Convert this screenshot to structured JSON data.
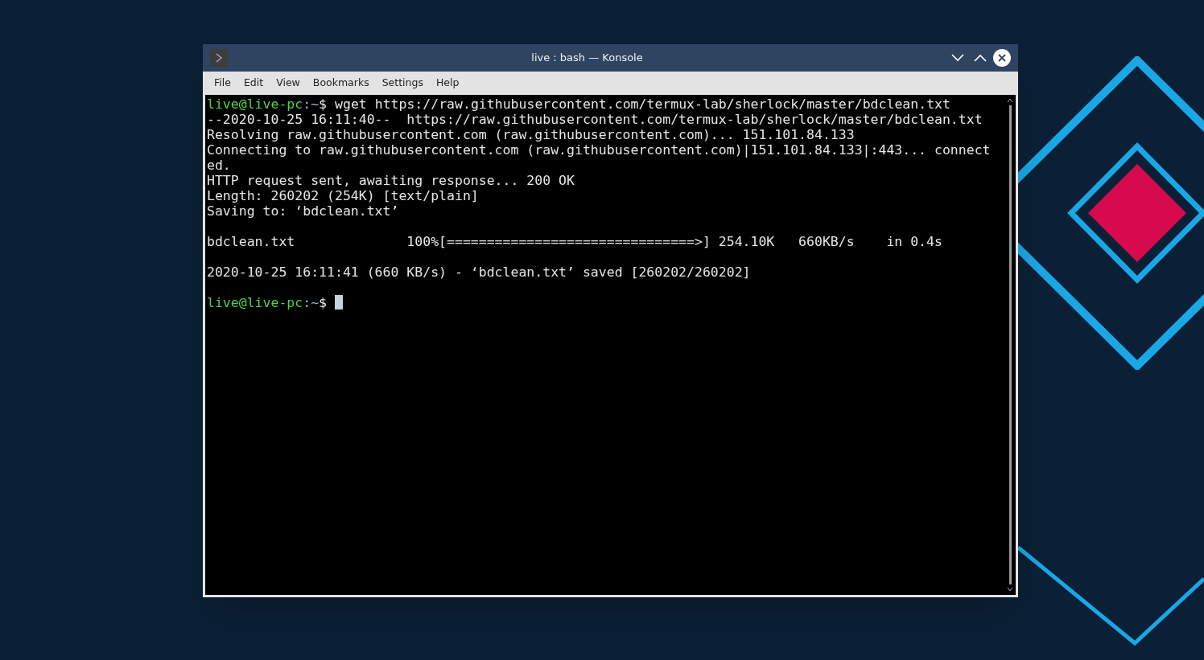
{
  "window": {
    "title": "live : bash — Konsole"
  },
  "menu": [
    "File",
    "Edit",
    "View",
    "Bookmarks",
    "Settings",
    "Help"
  ],
  "terminal": {
    "lines": [
      {
        "kind": "prompt",
        "user_host": "live@live-pc",
        "path": ":~",
        "symbol": "$",
        "command": "wget https://raw.githubusercontent.com/termux-lab/sherlock/master/bdclean.txt"
      },
      {
        "kind": "output",
        "text": "--2020-10-25 16:11:40--  https://raw.githubusercontent.com/termux-lab/sherlock/master/bdclean.txt"
      },
      {
        "kind": "output",
        "text": "Resolving raw.githubusercontent.com (raw.githubusercontent.com)... 151.101.84.133"
      },
      {
        "kind": "output",
        "text": "Connecting to raw.githubusercontent.com (raw.githubusercontent.com)|151.101.84.133|:443... connect"
      },
      {
        "kind": "output",
        "text": "ed."
      },
      {
        "kind": "output",
        "text": "HTTP request sent, awaiting response... 200 OK"
      },
      {
        "kind": "output",
        "text": "Length: 260202 (254K) [text/plain]"
      },
      {
        "kind": "output",
        "text": "Saving to: ‘bdclean.txt’"
      },
      {
        "kind": "blank"
      },
      {
        "kind": "output",
        "text": "bdclean.txt              100%[===============================>] 254.10K   660KB/s    in 0.4s"
      },
      {
        "kind": "blank"
      },
      {
        "kind": "output",
        "text": "2020-10-25 16:11:41 (660 KB/s) - ‘bdclean.txt’ saved [260202/260202]"
      },
      {
        "kind": "blank"
      },
      {
        "kind": "prompt",
        "user_host": "live@live-pc",
        "path": ":~",
        "symbol": "$",
        "cursor": true
      }
    ]
  }
}
